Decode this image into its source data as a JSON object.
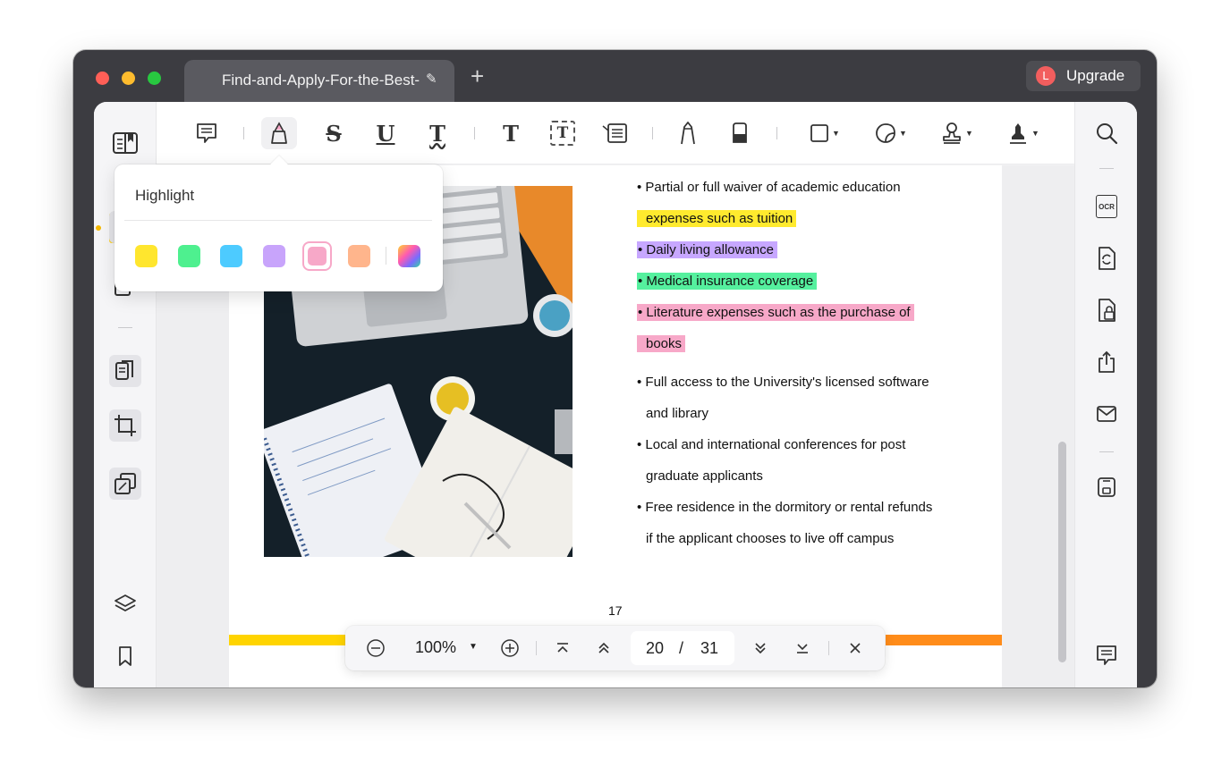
{
  "window": {
    "tab_title": "Find-and-Apply-For-the-Best-Institutes-In-The-World-For-Your-Future.pdf",
    "tab_edit_icon": "pencil-icon",
    "new_tab_icon": "plus-icon",
    "upgrade": {
      "avatar_letter": "L",
      "label": "Upgrade",
      "avatar_color": "#f25e5e"
    }
  },
  "left_sidebar": {
    "items": [
      "reader-mode-icon",
      "comment-mode-icon",
      "edit-pdf-icon",
      "organize-pages-icon",
      "crop-pages-icon",
      "page-tools-icon",
      "layers-icon",
      "bookmark-icon"
    ]
  },
  "toolbar": {
    "tools": [
      "note-icon",
      "highlight-icon",
      "strikethrough-icon",
      "underline-icon",
      "squiggly-icon",
      "text-icon",
      "text-box-icon",
      "text-callout-icon",
      "pencil-icon",
      "eraser-icon",
      "shape-icon",
      "sticker-icon",
      "stamp-icon",
      "signature-icon"
    ],
    "glyphs": {
      "strike": "S",
      "underline": "U",
      "squiggly": "T",
      "text": "T",
      "textbox": "T"
    }
  },
  "highlight_popover": {
    "title": "Highlight",
    "colors": [
      "#ffe62e",
      "#4ef08f",
      "#4dcbff",
      "#c8a4fb",
      "#f7a8c8",
      "#ffb58c"
    ],
    "selected_index": 4
  },
  "document": {
    "bullets": [
      {
        "text": "• Partial or full waiver of academic education",
        "highlight": ""
      },
      {
        "text": "expenses such as tuition",
        "highlight": "yellow"
      },
      {
        "text": "• Daily living allowance",
        "highlight": "purple"
      },
      {
        "text": "• Medical insurance coverage",
        "highlight": "green"
      },
      {
        "text": "• Literature expenses such as the purchase of",
        "highlight": "pink"
      },
      {
        "text": "books",
        "highlight": "pink"
      },
      {
        "text": "• Full access to the University's licensed software",
        "highlight": ""
      },
      {
        "text": "and library",
        "highlight": ""
      },
      {
        "text": "• Local and international conferences for post",
        "highlight": ""
      },
      {
        "text": "graduate applicants",
        "highlight": ""
      },
      {
        "text": "• Free residence in the dormitory or rental refunds",
        "highlight": ""
      },
      {
        "text": "if the applicant chooses to live off campus",
        "highlight": ""
      }
    ],
    "page_number": "17"
  },
  "right_sidebar": {
    "items": [
      "search-icon",
      "ocr-icon",
      "convert-icon",
      "protect-icon",
      "share-icon",
      "email-icon",
      "save-icon",
      "comment-list-icon"
    ],
    "ocr_label": "OCR"
  },
  "bottom_bar": {
    "zoom": "100%",
    "current_page": "20",
    "page_separator": "/",
    "total_pages": "31"
  }
}
